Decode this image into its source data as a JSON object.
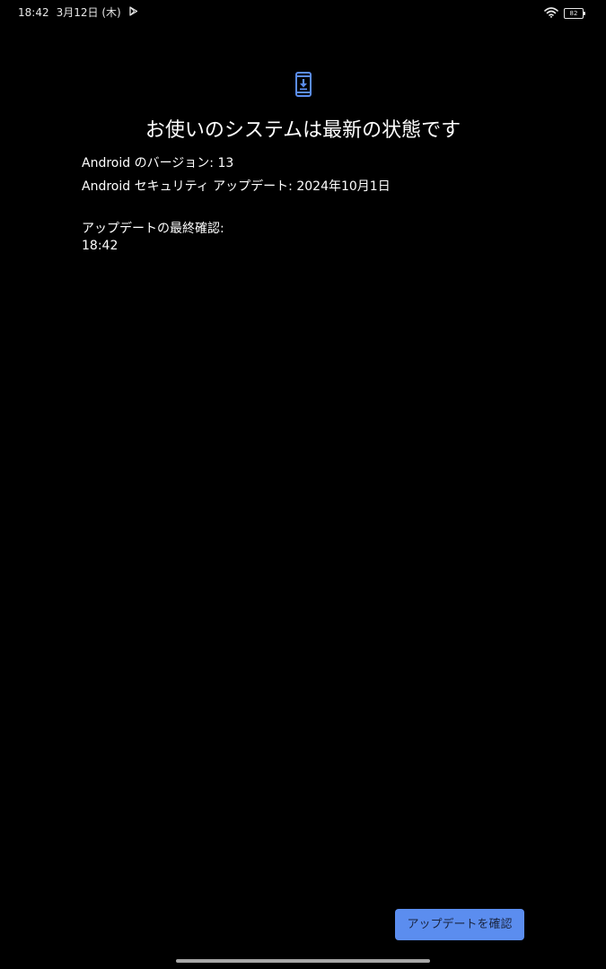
{
  "status_bar": {
    "time": "18:42",
    "date": "3月12日 (木)",
    "battery_level": "82",
    "icons": [
      "play-store-icon",
      "wifi-icon",
      "battery-icon"
    ]
  },
  "colors": {
    "background": "#000000",
    "accent": "#5b8def",
    "text": "#ffffff"
  },
  "main": {
    "icon": "system-update-icon",
    "title": "お使いのシステムは最新の状態です",
    "android_version": "Android のバージョン: 13",
    "security_update": "Android セキュリティ アップデート: 2024年10月1日",
    "last_check_label": "アップデートの最終確認:",
    "last_check_value": "18:42"
  },
  "actions": {
    "check_update_label": "アップデートを確認"
  }
}
